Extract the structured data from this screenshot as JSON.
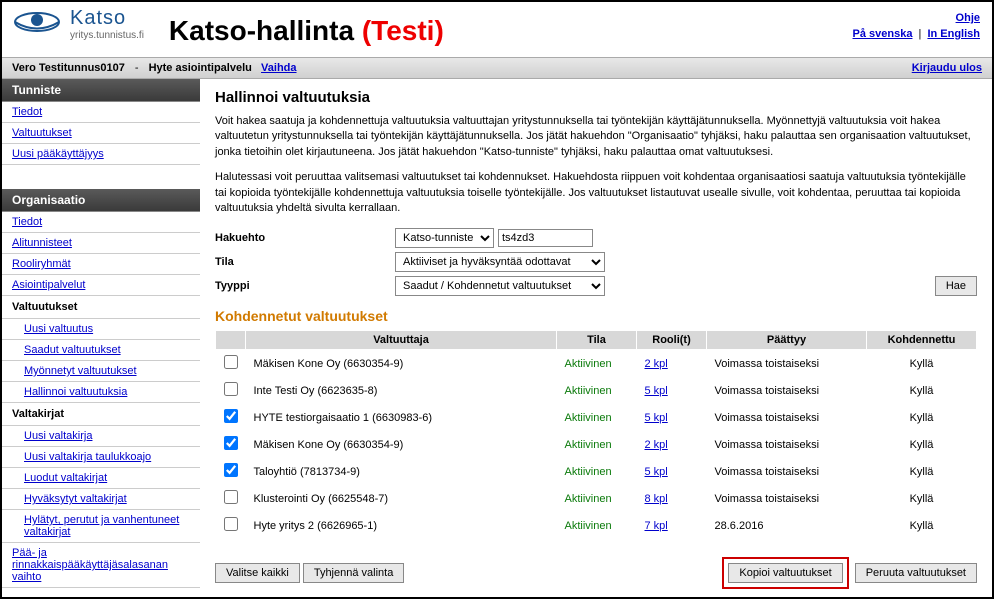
{
  "header": {
    "logo_main": "Katso",
    "logo_sub": "yritys.tunnistus.fi",
    "title_black": "Katso-hallinta",
    "title_red": "(Testi)",
    "links": {
      "ohje": "Ohje",
      "svenska": "På svenska",
      "english": "In English"
    }
  },
  "userbar": {
    "username": "Vero Testitunnus0107",
    "service": "Hyte asiointipalvelu",
    "switch": "Vaihda",
    "logout": "Kirjaudu ulos"
  },
  "sidebar": {
    "tunniste": {
      "header": "Tunniste",
      "items": [
        "Tiedot",
        "Valtuutukset",
        "Uusi pääkäyttäjyys"
      ]
    },
    "organisaatio": {
      "header": "Organisaatio",
      "items": [
        "Tiedot",
        "Alitunnisteet",
        "Rooliryhmät",
        "Asiointipalvelut"
      ],
      "valtuutukset": {
        "header": "Valtuutukset",
        "items": [
          "Uusi valtuutus",
          "Saadut valtuutukset",
          "Myönnetyt valtuutukset",
          "Hallinnoi valtuutuksia"
        ]
      },
      "valtakirjat": {
        "header": "Valtakirjat",
        "items": [
          "Uusi valtakirja",
          "Uusi valtakirja taulukkoajo",
          "Luodut valtakirjat",
          "Hyväksytyt valtakirjat",
          "Hylätyt, perutut ja vanhentuneet valtakirjat"
        ]
      },
      "bottom": "Pää- ja rinnakkaispääkäyttäjäsalasanan vaihto"
    }
  },
  "main": {
    "title": "Hallinnoi valtuutuksia",
    "para1": "Voit hakea saatuja ja kohdennettuja valtuutuksia valtuuttajan yritystunnuksella tai työntekijän käyttäjätunnuksella. Myönnettyjä valtuutuksia voit hakea valtuutetun yritystunnuksella tai työntekijän käyttäjätunnuksella. Jos jätät hakuehdon \"Organisaatio\" tyhjäksi, haku palauttaa sen organisaation valtuutukset, jonka tietoihin olet kirjautuneena. Jos jätät hakuehdon \"Katso-tunniste\" tyhjäksi, haku palauttaa omat valtuutuksesi.",
    "para2": "Halutessasi voit peruuttaa valitsemasi valtuutukset tai kohdennukset. Hakuehdosta riippuen voit kohdentaa organisaatiosi saatuja valtuutuksia työntekijälle tai kopioida työntekijälle kohdennettuja valtuutuksia toiselle työntekijälle. Jos valtuutukset listautuvat usealle sivulle, voit kohdentaa, peruuttaa tai kopioida valtuutuksia yhdeltä sivulta kerrallaan.",
    "form": {
      "hakuehto_label": "Hakuehto",
      "hakuehto_select": "Katso-tunniste",
      "hakuehto_value": "ts4zd3",
      "tila_label": "Tila",
      "tila_value": "Aktiiviset ja hyväksyntää odottavat",
      "tyyppi_label": "Tyyppi",
      "tyyppi_value": "Saadut / Kohdennetut valtuutukset",
      "hae": "Hae"
    },
    "section_title": "Kohdennetut valtuutukset",
    "columns": {
      "valtuuttaja": "Valtuuttaja",
      "tila": "Tila",
      "roolit": "Rooli(t)",
      "paattyy": "Päättyy",
      "kohdennettu": "Kohdennettu"
    },
    "rows": [
      {
        "checked": false,
        "valtuuttaja": "Mäkisen Kone Oy (6630354-9)",
        "tila": "Aktiivinen",
        "roolit": "2 kpl",
        "paattyy": "Voimassa toistaiseksi",
        "kohdennettu": "Kyllä"
      },
      {
        "checked": false,
        "valtuuttaja": "Inte Testi Oy (6623635-8)",
        "tila": "Aktiivinen",
        "roolit": "5 kpl",
        "paattyy": "Voimassa toistaiseksi",
        "kohdennettu": "Kyllä"
      },
      {
        "checked": true,
        "valtuuttaja": "HYTE testiorgaisaatio 1 (6630983-6)",
        "tila": "Aktiivinen",
        "roolit": "5 kpl",
        "paattyy": "Voimassa toistaiseksi",
        "kohdennettu": "Kyllä"
      },
      {
        "checked": true,
        "valtuuttaja": "Mäkisen Kone Oy (6630354-9)",
        "tila": "Aktiivinen",
        "roolit": "2 kpl",
        "paattyy": "Voimassa toistaiseksi",
        "kohdennettu": "Kyllä"
      },
      {
        "checked": true,
        "valtuuttaja": "Taloyhtiö (7813734-9)",
        "tila": "Aktiivinen",
        "roolit": "5 kpl",
        "paattyy": "Voimassa toistaiseksi",
        "kohdennettu": "Kyllä"
      },
      {
        "checked": false,
        "valtuuttaja": "Klusterointi Oy (6625548-7)",
        "tila": "Aktiivinen",
        "roolit": "8 kpl",
        "paattyy": "Voimassa toistaiseksi",
        "kohdennettu": "Kyllä"
      },
      {
        "checked": false,
        "valtuuttaja": "Hyte yritys 2 (6626965-1)",
        "tila": "Aktiivinen",
        "roolit": "7 kpl",
        "paattyy": "28.6.2016",
        "kohdennettu": "Kyllä"
      }
    ],
    "buttons": {
      "select_all": "Valitse kaikki",
      "clear": "Tyhjennä valinta",
      "copy": "Kopioi valtuutukset",
      "cancel": "Peruuta valtuutukset"
    }
  }
}
